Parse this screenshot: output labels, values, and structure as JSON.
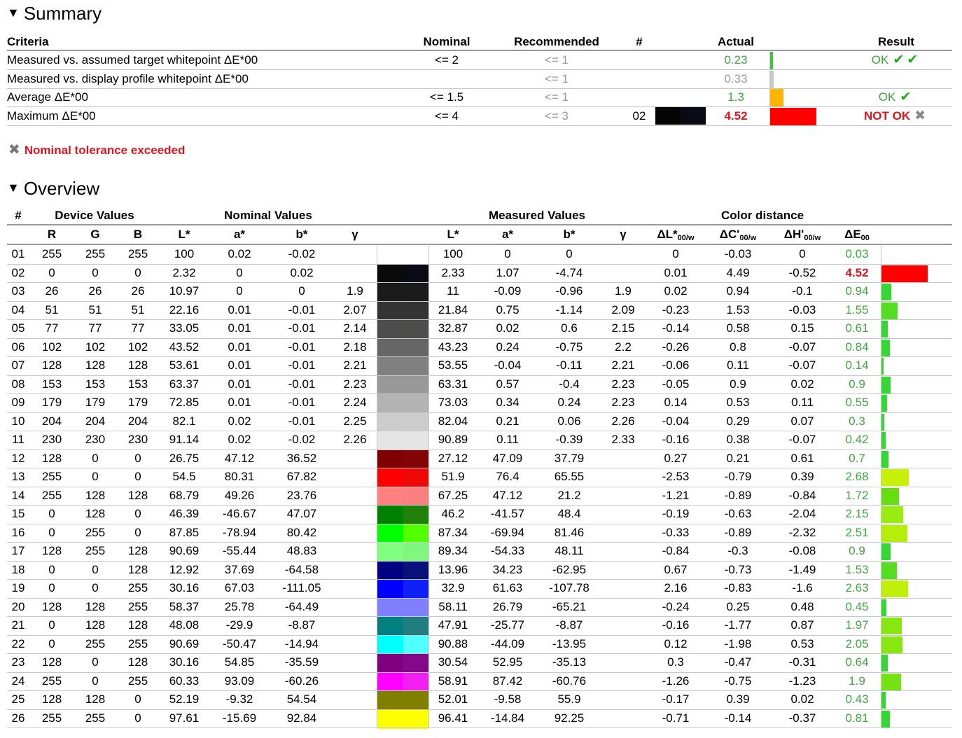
{
  "summary": {
    "title": "Summary",
    "headers": {
      "criteria": "Criteria",
      "nominal": "Nominal",
      "recommended": "Recommended",
      "num": "#",
      "actual": "Actual",
      "result": "Result"
    },
    "rows": [
      {
        "criteria": "Measured vs. assumed target whitepoint ΔE*00",
        "nominal": "<= 2",
        "recommended": "<= 1",
        "num": "",
        "actual": "0.23",
        "actual_status": "ok",
        "bar_value": 0.23,
        "bar_color": "#3cc83c",
        "result": "OK",
        "checks": "✔✔"
      },
      {
        "criteria": "Measured vs. display profile whitepoint ΔE*00",
        "nominal": "",
        "recommended": "<= 1",
        "num": "",
        "actual": "0.33",
        "actual_status": "info",
        "bar_value": 0.33,
        "bar_color": "#c8c8c8",
        "result": "",
        "checks": ""
      },
      {
        "criteria": "Average ΔE*00",
        "nominal": "<= 1.5",
        "recommended": "<= 1",
        "num": "",
        "actual": "1.3",
        "actual_status": "ok",
        "bar_value": 1.3,
        "bar_color": "#ffb400",
        "result": "OK",
        "checks": "✔"
      },
      {
        "criteria": "Maximum ΔE*00",
        "nominal": "<= 4",
        "recommended": "<= 3",
        "num": "02",
        "actual": "4.52",
        "actual_status": "fail",
        "bar_value": 4.52,
        "bar_color": "#ff0000",
        "result": "NOT OK",
        "checks": "✖",
        "swatch": [
          "#050505",
          "#0a0a14"
        ]
      }
    ],
    "warning": "Nominal tolerance exceeded"
  },
  "overview": {
    "title": "Overview",
    "groups": {
      "num": "#",
      "device": "Device Values",
      "nominal": "Nominal Values",
      "measured": "Measured Values",
      "distance": "Color distance"
    },
    "subheaders": [
      "R",
      "G",
      "B",
      "L*",
      "a*",
      "b*",
      "γ",
      "L*",
      "a*",
      "b*",
      "γ"
    ],
    "dist_headers": [
      {
        "main": "ΔL*",
        "sub": "00/w"
      },
      {
        "main": "ΔC'",
        "sub": "00/w"
      },
      {
        "main": "ΔH'",
        "sub": "00/w"
      },
      {
        "main": "ΔE",
        "sub": "00"
      }
    ],
    "rows": [
      {
        "n": "01",
        "rgb": [
          "255",
          "255",
          "255"
        ],
        "nom": [
          "100",
          "0.02",
          "-0.02",
          ""
        ],
        "meas": [
          "100",
          "0",
          "0",
          ""
        ],
        "dist": [
          "0",
          "-0.03",
          "0",
          "0.03"
        ],
        "de": 0.03,
        "sw": [
          "#ffffff",
          "#ffffff"
        ],
        "bar": "#ffffff"
      },
      {
        "n": "02",
        "rgb": [
          "0",
          "0",
          "0"
        ],
        "nom": [
          "2.32",
          "0",
          "0.02",
          ""
        ],
        "meas": [
          "2.33",
          "1.07",
          "-4.74",
          ""
        ],
        "dist": [
          "0.01",
          "4.49",
          "-0.52",
          "4.52"
        ],
        "de": 4.52,
        "sw": [
          "#0a0a0a",
          "#0a0a14"
        ],
        "bar": "#ff0000"
      },
      {
        "n": "03",
        "rgb": [
          "26",
          "26",
          "26"
        ],
        "nom": [
          "10.97",
          "0",
          "0",
          "1.9"
        ],
        "meas": [
          "11",
          "-0.09",
          "-0.96",
          "1.9"
        ],
        "dist": [
          "0.02",
          "0.94",
          "-0.1",
          "0.94"
        ],
        "de": 0.94,
        "sw": [
          "#1a1a1a",
          "#1b1b1c"
        ],
        "bar": "#33d833"
      },
      {
        "n": "04",
        "rgb": [
          "51",
          "51",
          "51"
        ],
        "nom": [
          "22.16",
          "0.01",
          "-0.01",
          "2.07"
        ],
        "meas": [
          "21.84",
          "0.75",
          "-1.14",
          "2.09"
        ],
        "dist": [
          "-0.23",
          "1.53",
          "-0.03",
          "1.55"
        ],
        "de": 1.55,
        "sw": [
          "#333333",
          "#333334"
        ],
        "bar": "#55dd22"
      },
      {
        "n": "05",
        "rgb": [
          "77",
          "77",
          "77"
        ],
        "nom": [
          "33.05",
          "0.01",
          "-0.01",
          "2.14"
        ],
        "meas": [
          "32.87",
          "0.02",
          "0.6",
          "2.15"
        ],
        "dist": [
          "-0.14",
          "0.58",
          "0.15",
          "0.61"
        ],
        "de": 0.61,
        "sw": [
          "#4d4d4d",
          "#4d4d4c"
        ],
        "bar": "#33d833"
      },
      {
        "n": "06",
        "rgb": [
          "102",
          "102",
          "102"
        ],
        "nom": [
          "43.52",
          "0.01",
          "-0.01",
          "2.18"
        ],
        "meas": [
          "43.23",
          "0.24",
          "-0.75",
          "2.2"
        ],
        "dist": [
          "-0.26",
          "0.8",
          "-0.07",
          "0.84"
        ],
        "de": 0.84,
        "sw": [
          "#666666",
          "#666667"
        ],
        "bar": "#33d833"
      },
      {
        "n": "07",
        "rgb": [
          "128",
          "128",
          "128"
        ],
        "nom": [
          "53.61",
          "0.01",
          "-0.01",
          "2.21"
        ],
        "meas": [
          "53.55",
          "-0.04",
          "-0.11",
          "2.21"
        ],
        "dist": [
          "-0.06",
          "0.11",
          "-0.07",
          "0.14"
        ],
        "de": 0.14,
        "sw": [
          "#808080",
          "#808080"
        ],
        "bar": "#33d833"
      },
      {
        "n": "08",
        "rgb": [
          "153",
          "153",
          "153"
        ],
        "nom": [
          "63.37",
          "0.01",
          "-0.01",
          "2.23"
        ],
        "meas": [
          "63.31",
          "0.57",
          "-0.4",
          "2.23"
        ],
        "dist": [
          "-0.05",
          "0.9",
          "0.02",
          "0.9"
        ],
        "de": 0.9,
        "sw": [
          "#999999",
          "#9a9999"
        ],
        "bar": "#33d833"
      },
      {
        "n": "09",
        "rgb": [
          "179",
          "179",
          "179"
        ],
        "nom": [
          "72.85",
          "0.01",
          "-0.01",
          "2.24"
        ],
        "meas": [
          "73.03",
          "0.34",
          "0.24",
          "2.23"
        ],
        "dist": [
          "0.14",
          "0.53",
          "0.11",
          "0.55"
        ],
        "de": 0.55,
        "sw": [
          "#b3b3b3",
          "#b4b3b3"
        ],
        "bar": "#33d833"
      },
      {
        "n": "10",
        "rgb": [
          "204",
          "204",
          "204"
        ],
        "nom": [
          "82.1",
          "0.02",
          "-0.01",
          "2.25"
        ],
        "meas": [
          "82.04",
          "0.21",
          "0.06",
          "2.26"
        ],
        "dist": [
          "-0.04",
          "0.29",
          "0.07",
          "0.3"
        ],
        "de": 0.3,
        "sw": [
          "#cccccc",
          "#cccccc"
        ],
        "bar": "#33d833"
      },
      {
        "n": "11",
        "rgb": [
          "230",
          "230",
          "230"
        ],
        "nom": [
          "91.14",
          "0.02",
          "-0.02",
          "2.26"
        ],
        "meas": [
          "90.89",
          "0.11",
          "-0.39",
          "2.33"
        ],
        "dist": [
          "-0.16",
          "0.38",
          "-0.07",
          "0.42"
        ],
        "de": 0.42,
        "sw": [
          "#e6e6e6",
          "#e5e5e6"
        ],
        "bar": "#33d833"
      },
      {
        "n": "12",
        "rgb": [
          "128",
          "0",
          "0"
        ],
        "nom": [
          "26.75",
          "47.12",
          "36.52",
          ""
        ],
        "meas": [
          "27.12",
          "47.09",
          "37.79",
          ""
        ],
        "dist": [
          "0.27",
          "0.21",
          "0.61",
          "0.7"
        ],
        "de": 0.7,
        "sw": [
          "#800000",
          "#820404"
        ],
        "bar": "#33d833"
      },
      {
        "n": "13",
        "rgb": [
          "255",
          "0",
          "0"
        ],
        "nom": [
          "54.5",
          "80.31",
          "67.82",
          ""
        ],
        "meas": [
          "51.9",
          "76.4",
          "65.55",
          ""
        ],
        "dist": [
          "-2.53",
          "-0.79",
          "0.39",
          "2.68"
        ],
        "de": 2.68,
        "sw": [
          "#ff0000",
          "#f00808"
        ],
        "bar": "#c8f00a"
      },
      {
        "n": "14",
        "rgb": [
          "255",
          "128",
          "128"
        ],
        "nom": [
          "68.79",
          "49.26",
          "23.76",
          ""
        ],
        "meas": [
          "67.25",
          "47.12",
          "21.2",
          ""
        ],
        "dist": [
          "-1.21",
          "-0.89",
          "-0.84",
          "1.72"
        ],
        "de": 1.72,
        "sw": [
          "#ff8080",
          "#f88080"
        ],
        "bar": "#66dd11"
      },
      {
        "n": "15",
        "rgb": [
          "0",
          "128",
          "0"
        ],
        "nom": [
          "46.39",
          "-46.67",
          "47.07",
          ""
        ],
        "meas": [
          "46.2",
          "-41.57",
          "48.4",
          ""
        ],
        "dist": [
          "-0.19",
          "-0.63",
          "-2.04",
          "2.15"
        ],
        "de": 2.15,
        "sw": [
          "#008000",
          "#208008"
        ],
        "bar": "#99ee11"
      },
      {
        "n": "16",
        "rgb": [
          "0",
          "255",
          "0"
        ],
        "nom": [
          "87.85",
          "-78.94",
          "80.42",
          ""
        ],
        "meas": [
          "87.34",
          "-69.94",
          "81.46",
          ""
        ],
        "dist": [
          "-0.33",
          "-0.89",
          "-2.32",
          "2.51"
        ],
        "de": 2.51,
        "sw": [
          "#00ff00",
          "#50ff00"
        ],
        "bar": "#b4ee0a"
      },
      {
        "n": "17",
        "rgb": [
          "128",
          "255",
          "128"
        ],
        "nom": [
          "90.69",
          "-55.44",
          "48.83",
          ""
        ],
        "meas": [
          "89.34",
          "-54.33",
          "48.11",
          ""
        ],
        "dist": [
          "-0.84",
          "-0.3",
          "-0.08",
          "0.9"
        ],
        "de": 0.9,
        "sw": [
          "#80ff80",
          "#80f880"
        ],
        "bar": "#33d833"
      },
      {
        "n": "18",
        "rgb": [
          "0",
          "0",
          "128"
        ],
        "nom": [
          "12.92",
          "37.69",
          "-64.58",
          ""
        ],
        "meas": [
          "13.96",
          "34.23",
          "-62.95",
          ""
        ],
        "dist": [
          "0.67",
          "-0.73",
          "-1.49",
          "1.53"
        ],
        "de": 1.53,
        "sw": [
          "#000080",
          "#08107a"
        ],
        "bar": "#55dd22"
      },
      {
        "n": "19",
        "rgb": [
          "0",
          "0",
          "255"
        ],
        "nom": [
          "30.16",
          "67.03",
          "-111.05",
          ""
        ],
        "meas": [
          "32.9",
          "61.63",
          "-107.78",
          ""
        ],
        "dist": [
          "2.16",
          "-0.83",
          "-1.6",
          "2.63"
        ],
        "de": 2.63,
        "sw": [
          "#0000ff",
          "#1020f8"
        ],
        "bar": "#c0f00a"
      },
      {
        "n": "20",
        "rgb": [
          "128",
          "128",
          "255"
        ],
        "nom": [
          "58.37",
          "25.78",
          "-64.49",
          ""
        ],
        "meas": [
          "58.11",
          "26.79",
          "-65.21",
          ""
        ],
        "dist": [
          "-0.24",
          "0.25",
          "0.48",
          "0.45"
        ],
        "de": 0.45,
        "sw": [
          "#8080ff",
          "#8080ff"
        ],
        "bar": "#33d833"
      },
      {
        "n": "21",
        "rgb": [
          "0",
          "128",
          "128"
        ],
        "nom": [
          "48.08",
          "-29.9",
          "-8.87",
          ""
        ],
        "meas": [
          "47.91",
          "-25.77",
          "-8.87",
          ""
        ],
        "dist": [
          "-0.16",
          "-1.77",
          "0.87",
          "1.97"
        ],
        "de": 1.97,
        "sw": [
          "#008080",
          "#207e80"
        ],
        "bar": "#88e611"
      },
      {
        "n": "22",
        "rgb": [
          "0",
          "255",
          "255"
        ],
        "nom": [
          "90.69",
          "-50.47",
          "-14.94",
          ""
        ],
        "meas": [
          "90.88",
          "-44.09",
          "-13.95",
          ""
        ],
        "dist": [
          "0.12",
          "-1.98",
          "0.53",
          "2.05"
        ],
        "de": 2.05,
        "sw": [
          "#00ffff",
          "#50ffff"
        ],
        "bar": "#88e611"
      },
      {
        "n": "23",
        "rgb": [
          "128",
          "0",
          "128"
        ],
        "nom": [
          "30.16",
          "54.85",
          "-35.59",
          ""
        ],
        "meas": [
          "30.54",
          "52.95",
          "-35.13",
          ""
        ],
        "dist": [
          "0.3",
          "-0.47",
          "-0.31",
          "0.64"
        ],
        "de": 0.64,
        "sw": [
          "#800080",
          "#84088a"
        ],
        "bar": "#33d833"
      },
      {
        "n": "24",
        "rgb": [
          "255",
          "0",
          "255"
        ],
        "nom": [
          "60.33",
          "93.09",
          "-60.26",
          ""
        ],
        "meas": [
          "58.91",
          "87.42",
          "-60.76",
          ""
        ],
        "dist": [
          "-1.26",
          "-0.75",
          "-1.23",
          "1.9"
        ],
        "de": 1.9,
        "sw": [
          "#ff00ff",
          "#f020f0"
        ],
        "bar": "#77e211"
      },
      {
        "n": "25",
        "rgb": [
          "128",
          "128",
          "0"
        ],
        "nom": [
          "52.19",
          "-9.32",
          "54.54",
          ""
        ],
        "meas": [
          "52.01",
          "-9.58",
          "55.9",
          ""
        ],
        "dist": [
          "-0.17",
          "0.39",
          "0.02",
          "0.43"
        ],
        "de": 0.43,
        "sw": [
          "#808000",
          "#808000"
        ],
        "bar": "#33d833"
      },
      {
        "n": "26",
        "rgb": [
          "255",
          "255",
          "0"
        ],
        "nom": [
          "97.61",
          "-15.69",
          "92.84",
          ""
        ],
        "meas": [
          "96.41",
          "-14.84",
          "92.25",
          ""
        ],
        "dist": [
          "-0.71",
          "-0.14",
          "-0.37",
          "0.81"
        ],
        "de": 0.81,
        "sw": [
          "#ffff00",
          "#ffff00"
        ],
        "bar": "#33d833"
      }
    ]
  }
}
